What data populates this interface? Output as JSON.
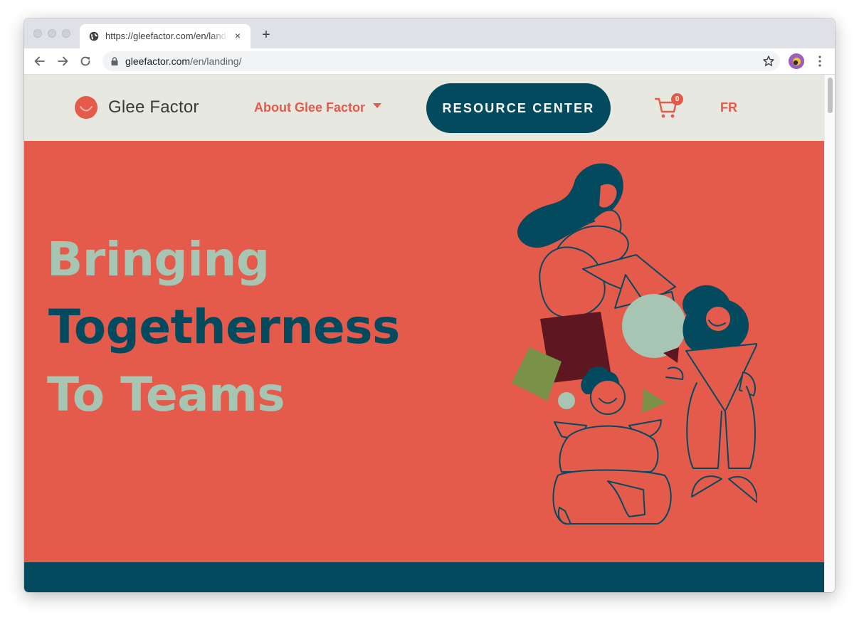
{
  "browser": {
    "tab_title": "https://gleefactor.com/en/landing/",
    "tab_close_icon": "×",
    "new_tab_icon": "+",
    "url_host": "gleefactor.com",
    "url_path": "/en/landing/"
  },
  "header": {
    "logo_text": "Glee Factor",
    "about_label": "About Glee Factor",
    "resource_center_label": "RESOURCE CENTER",
    "cart_count": "0",
    "language_label": "FR"
  },
  "hero": {
    "line1": "Bringing",
    "line2": "Togetherness",
    "line3": "To Teams"
  },
  "colors": {
    "coral": "#e45b4b",
    "teal": "#034a5f",
    "sage": "#a6c5b3",
    "olive": "#7a9148",
    "maroon": "#5e1620",
    "header_bg": "#e7e8e0"
  },
  "icons": [
    "globe-icon",
    "close-icon",
    "plus-icon",
    "back-icon",
    "forward-icon",
    "reload-icon",
    "lock-icon",
    "star-icon",
    "avatar",
    "more-icon",
    "logo-smile-icon",
    "caret-down-icon",
    "cart-icon"
  ]
}
